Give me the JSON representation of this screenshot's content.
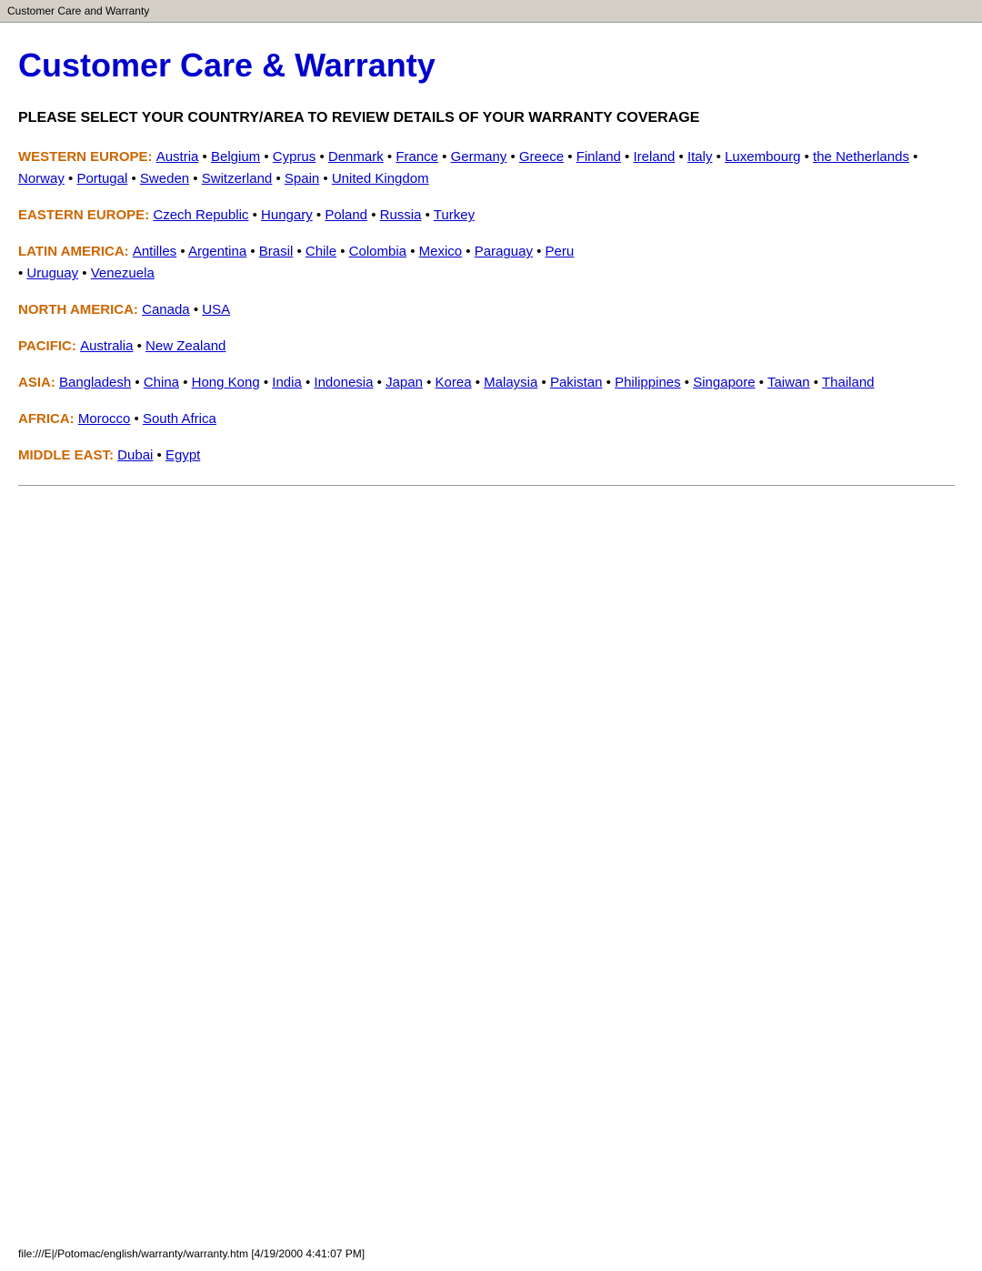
{
  "tab": {
    "title": "Customer Care and Warranty"
  },
  "page": {
    "heading": "Customer Care & Warranty",
    "subtitle": "PLEASE SELECT YOUR COUNTRY/AREA TO REVIEW DETAILS OF YOUR WARRANTY COVERAGE"
  },
  "regions": [
    {
      "id": "western-europe",
      "label": "WESTERN EUROPE:",
      "countries": [
        "Austria",
        "Belgium",
        "Cyprus",
        "Denmark",
        "France",
        "Germany",
        "Greece",
        "Finland",
        "Ireland",
        "Italy",
        "Luxembourg",
        "the Netherlands",
        "Norway",
        "Portugal",
        "Sweden",
        "Switzerland",
        "Spain",
        "United Kingdom"
      ]
    },
    {
      "id": "eastern-europe",
      "label": "EASTERN EUROPE:",
      "countries": [
        "Czech Republic",
        "Hungary",
        "Poland",
        "Russia",
        "Turkey"
      ]
    },
    {
      "id": "latin-america",
      "label": "LATIN AMERICA:",
      "countries": [
        "Antilles",
        "Argentina",
        "Brasil",
        "Chile",
        "Colombia",
        "Mexico",
        "Paraguay",
        "Peru",
        "Uruguay",
        "Venezuela"
      ]
    },
    {
      "id": "north-america",
      "label": "NORTH AMERICA:",
      "countries": [
        "Canada",
        "USA"
      ]
    },
    {
      "id": "pacific",
      "label": "PACIFIC:",
      "countries": [
        "Australia",
        "New Zealand"
      ]
    },
    {
      "id": "asia",
      "label": "ASIA:",
      "countries": [
        "Bangladesh",
        "China",
        "Hong Kong",
        "India",
        "Indonesia",
        "Japan",
        "Korea",
        "Malaysia",
        "Pakistan",
        "Philippines",
        "Singapore",
        "Taiwan",
        "Thailand"
      ]
    },
    {
      "id": "africa",
      "label": "AFRICA:",
      "countries": [
        "Morocco",
        "South Africa"
      ]
    },
    {
      "id": "middle-east",
      "label": "MIDDLE EAST:",
      "countries": [
        "Dubai",
        "Egypt"
      ]
    }
  ],
  "status_bar": {
    "text": "file:///E|/Potomac/english/warranty/warranty.htm [4/19/2000 4:41:07 PM]"
  }
}
